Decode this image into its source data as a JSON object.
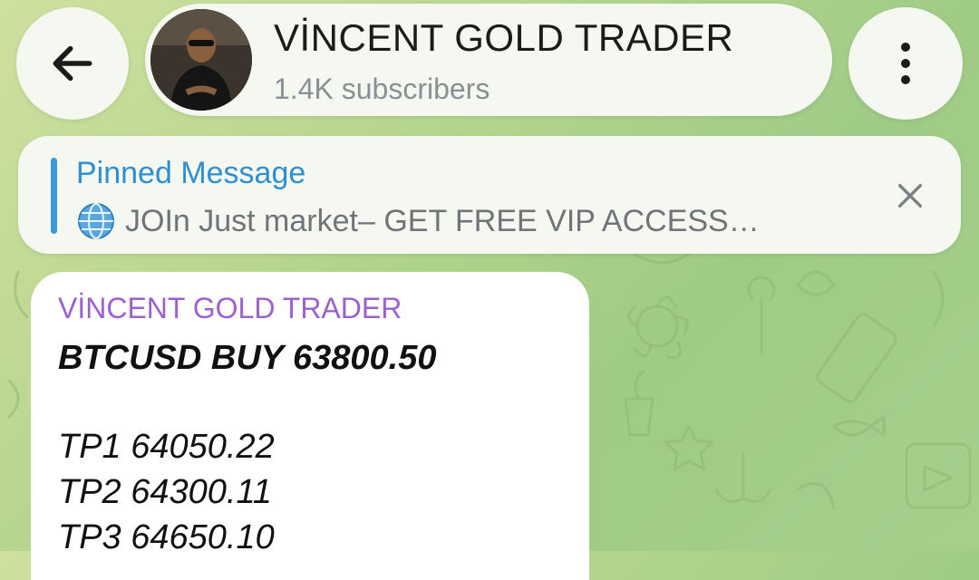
{
  "header": {
    "back_icon": "arrow-left-icon",
    "title": "VİNCENT GOLD TRADER",
    "subtitle": "1.4K subscribers",
    "menu_icon": "more-vertical-icon"
  },
  "pinned": {
    "title": "Pinned Message",
    "icon": "globe-icon",
    "text": "JOIn Just market– GET FREE VIP ACCESS…",
    "accent_color": "#3a9bdc"
  },
  "message": {
    "sender": "VİNCENT GOLD TRADER",
    "sender_color": "#9b62cf",
    "headline": "BTCUSD BUY 63800.50",
    "tp1": "TP1 64050.22",
    "tp2": "TP2 64300.11",
    "tp3": "TP3 64650.10"
  }
}
